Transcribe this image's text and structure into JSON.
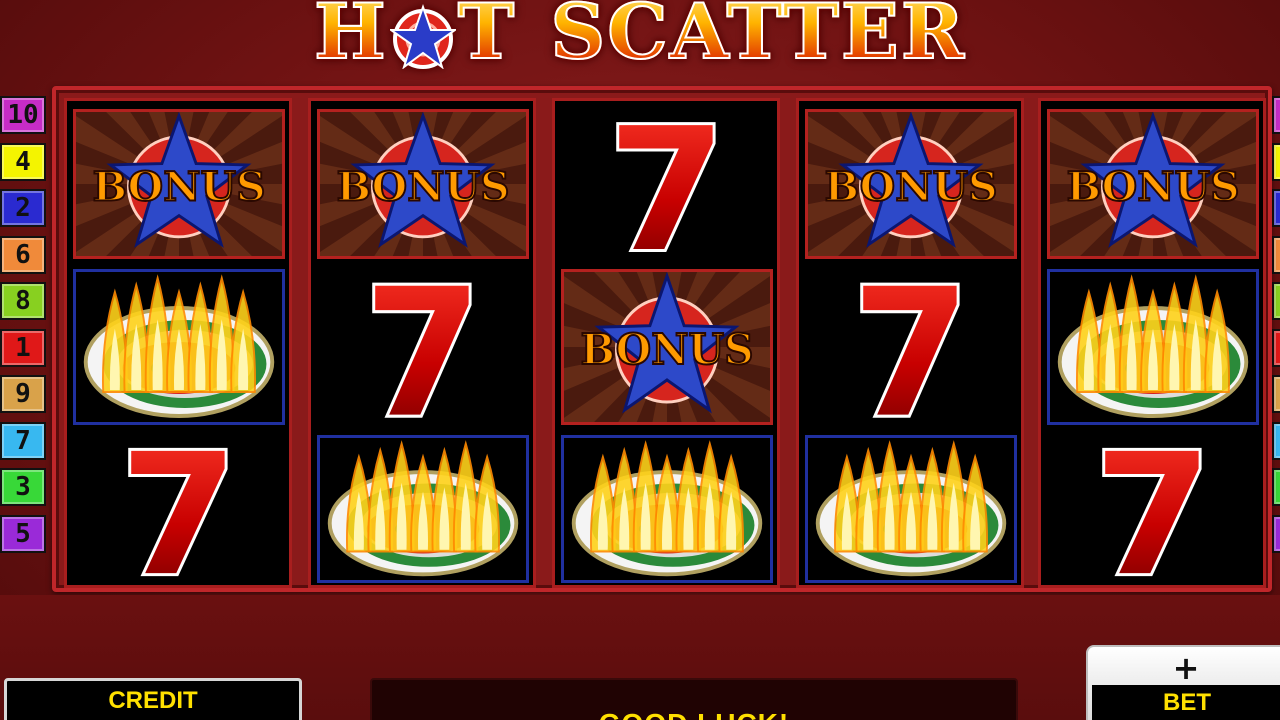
{
  "game": {
    "title_word1_start": "H",
    "title_word1_end": "T",
    "title_word2": "SCATTER"
  },
  "paylines": {
    "left": [
      {
        "number": "10",
        "color": "#c62cc6"
      },
      {
        "number": "4",
        "color": "#f4f400"
      },
      {
        "number": "2",
        "color": "#2a2ad0"
      },
      {
        "number": "6",
        "color": "#f08a3a"
      },
      {
        "number": "8",
        "color": "#88d020"
      },
      {
        "number": "1",
        "color": "#e01818"
      },
      {
        "number": "9",
        "color": "#d9a24a"
      },
      {
        "number": "7",
        "color": "#38b8f0"
      },
      {
        "number": "3",
        "color": "#38d838"
      },
      {
        "number": "5",
        "color": "#9a2ad8"
      }
    ],
    "right_colors": [
      "#c62cc6",
      "#f4f400",
      "#2a2ad0",
      "#f08a3a",
      "#88d020",
      "#e01818",
      "#d9a24a",
      "#38b8f0",
      "#38d838",
      "#9a2ad8"
    ]
  },
  "symbols": {
    "bonus": "BONUS",
    "seven": "7",
    "icons": {
      "bonus": "bonus-star-icon",
      "seven": "red-seven-icon",
      "melon": "hot-melon-icon"
    }
  },
  "reels": [
    [
      "bonus",
      "melon",
      "seven"
    ],
    [
      "bonus",
      "seven",
      "melon"
    ],
    [
      "seven",
      "bonus",
      "melon"
    ],
    [
      "bonus",
      "seven",
      "melon"
    ],
    [
      "bonus",
      "melon",
      "seven"
    ]
  ],
  "controls": {
    "credit_label": "CREDIT",
    "message": "GOOD LUCK!",
    "bet_plus": "+",
    "bet_label": "BET"
  }
}
